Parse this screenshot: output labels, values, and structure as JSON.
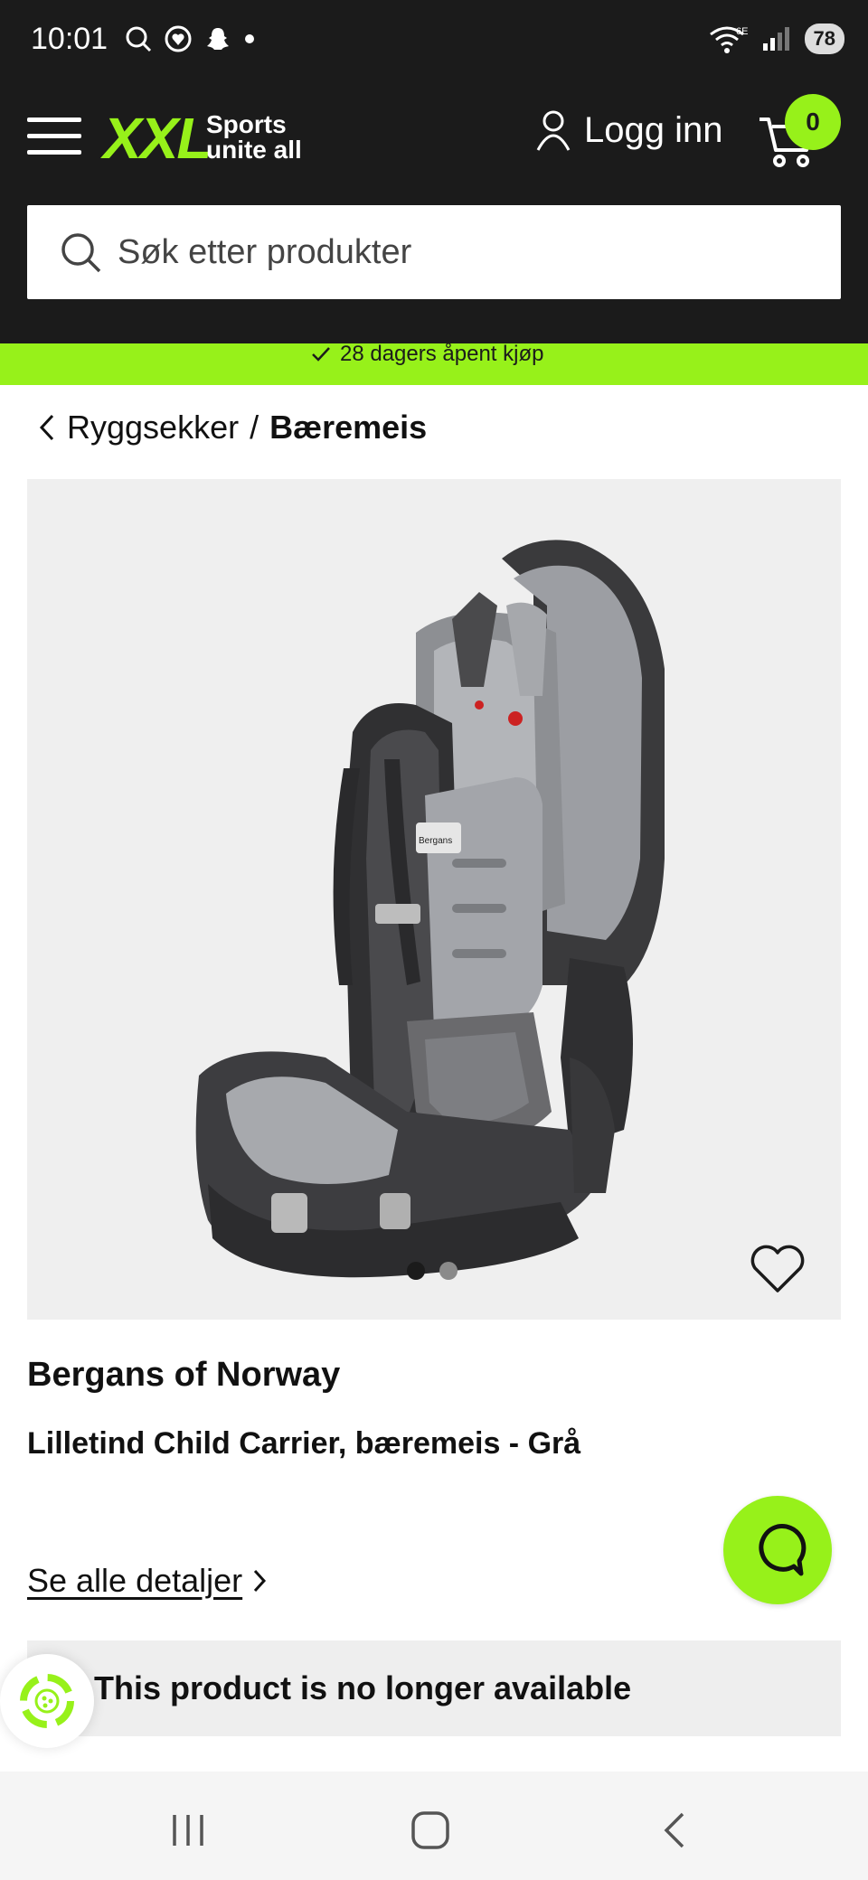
{
  "status_bar": {
    "time": "10:01",
    "network": "6E",
    "battery": "78"
  },
  "header": {
    "logo": "XXL",
    "tagline_line1": "Sports",
    "tagline_line2": "unite all",
    "login_label": "Logg inn",
    "cart_count": "0",
    "accent_color": "#97f11a",
    "background_color": "#1b1b1b"
  },
  "search": {
    "placeholder": "Søk etter produkter"
  },
  "promo": {
    "text": "28 dagers åpent kjøp"
  },
  "breadcrumb": {
    "parent": "Ryggsekker",
    "separator": "/",
    "current": "Bæremeis"
  },
  "gallery": {
    "image_count": 2,
    "active_index": 0,
    "brand_mark": "Bergans"
  },
  "product": {
    "brand": "Bergans of Norway",
    "name": "Lilletind Child Carrier, bæremeis - Grå",
    "details_link": "Se alle detaljer"
  },
  "availability": {
    "message": "This product is no longer available"
  },
  "icons": {
    "menu": "hamburger-icon",
    "user": "user-icon",
    "cart": "cart-icon",
    "search": "search-icon",
    "favorite": "heart-icon",
    "chat": "chat-icon",
    "cookie": "cookie-settings-icon"
  }
}
